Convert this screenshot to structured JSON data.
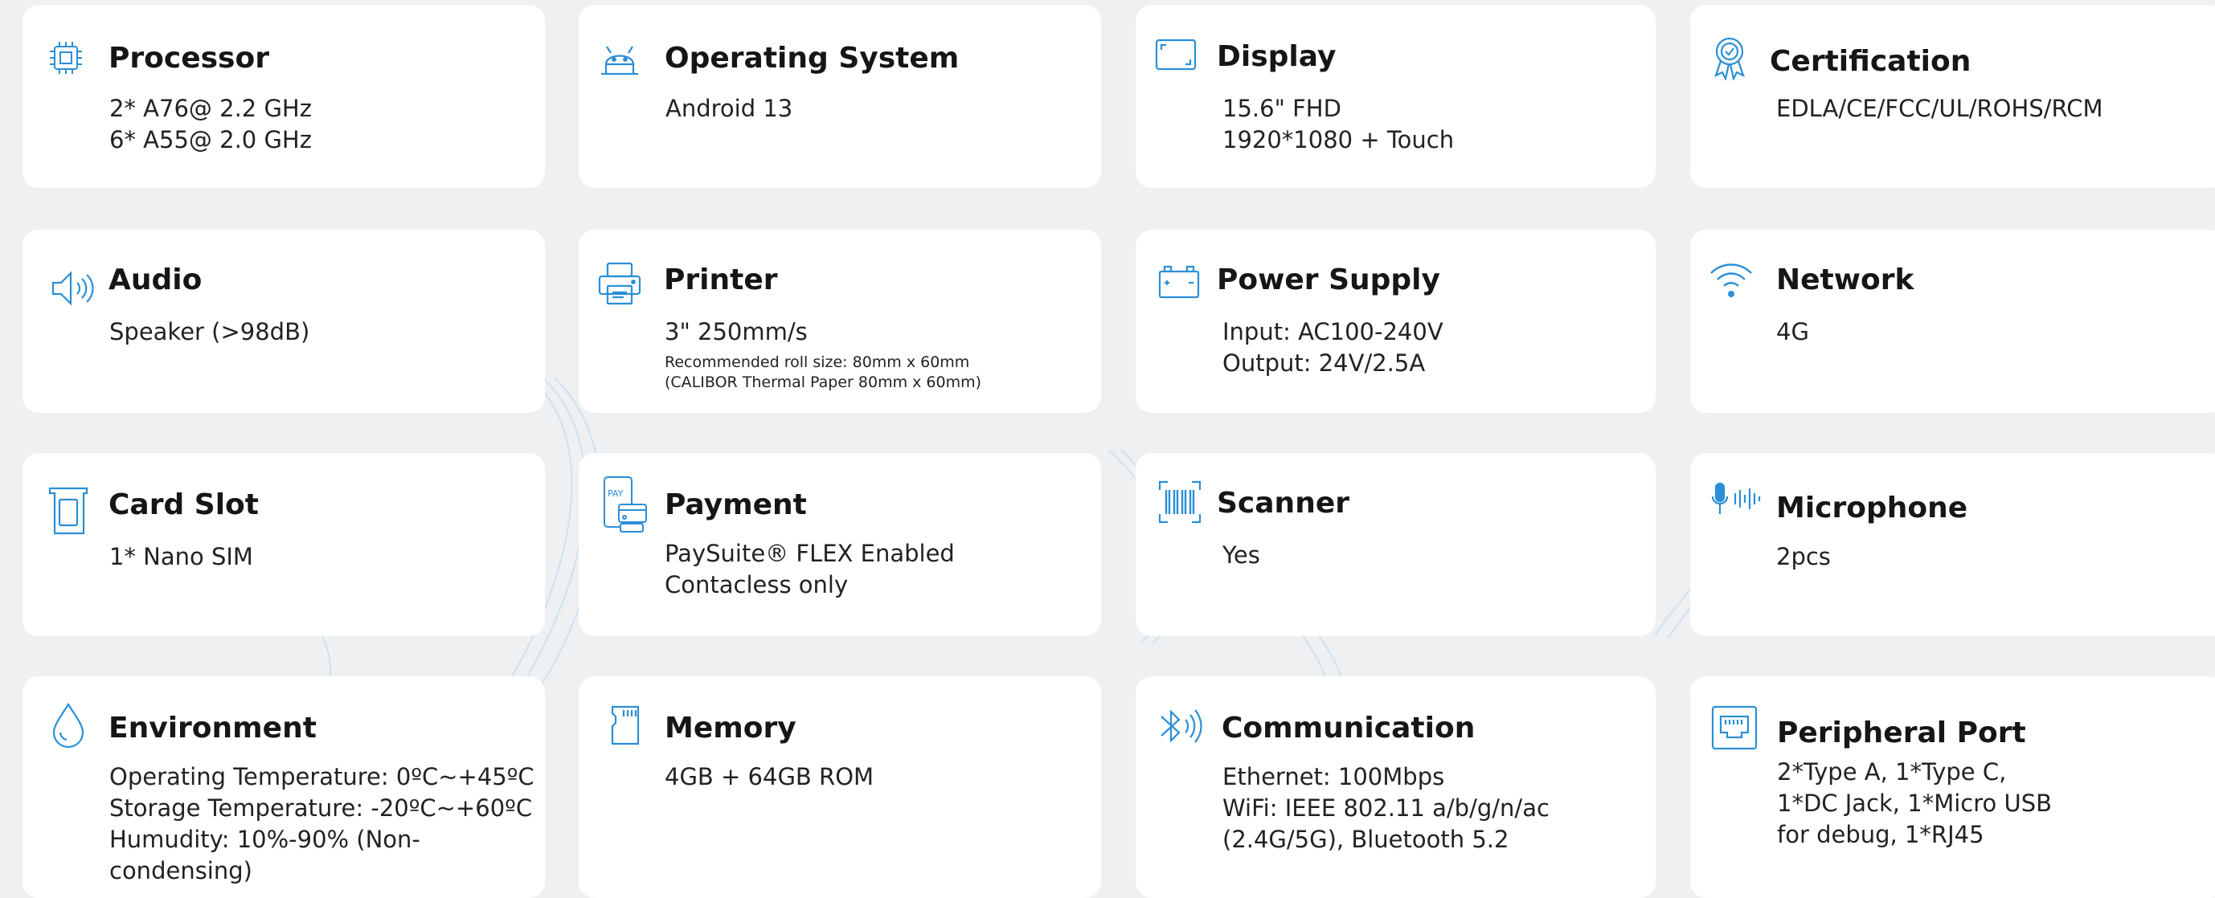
{
  "specs": [
    {
      "icon": "processor-icon",
      "title": "Processor",
      "lines": [
        "2* A76@ 2.2 GHz",
        "6* A55@ 2.0 GHz"
      ]
    },
    {
      "icon": "android-icon",
      "title": "Operating System",
      "lines": [
        "Android 13"
      ]
    },
    {
      "icon": "display-icon",
      "title": "Display",
      "lines": [
        "15.6\" FHD",
        "1920*1080 + Touch"
      ]
    },
    {
      "icon": "certification-badge-icon",
      "title": "Certification",
      "lines": [
        "EDLA/CE/FCC/UL/ROHS/RCM"
      ]
    },
    {
      "icon": "speaker-icon",
      "title": "Audio",
      "lines": [
        "Speaker (>98dB)"
      ]
    },
    {
      "icon": "printer-icon",
      "title": "Printer",
      "lines": [
        "3\" 250mm/s"
      ],
      "notes": [
        "Recommended roll size: 80mm x 60mm",
        "(CALIBOR Thermal Paper 80mm x 60mm)"
      ]
    },
    {
      "icon": "battery-icon",
      "title": "Power Supply",
      "lines": [
        "Input: AC100-240V",
        "Output: 24V/2.5A"
      ]
    },
    {
      "icon": "wifi-icon",
      "title": "Network",
      "lines": [
        "4G"
      ]
    },
    {
      "icon": "sim-card-icon",
      "title": "Card Slot",
      "lines": [
        "1* Nano SIM"
      ]
    },
    {
      "icon": "payment-icon",
      "icon_text": "PAY",
      "title": "Payment",
      "lines": [
        "PaySuite® FLEX Enabled",
        "Contacless only"
      ]
    },
    {
      "icon": "barcode-scanner-icon",
      "title": "Scanner",
      "lines": [
        "Yes"
      ]
    },
    {
      "icon": "microphone-icon",
      "title": "Microphone",
      "lines": [
        "2pcs"
      ]
    },
    {
      "icon": "water-drop-icon",
      "title": "Environment",
      "lines": [
        "Operating Temperature: 0ºC~+45ºC",
        "Storage Temperature: -20ºC~+60ºC",
        "Humudity: 10%-90% (Non-",
        "condensing)"
      ]
    },
    {
      "icon": "memory-card-icon",
      "title": "Memory",
      "lines": [
        "4GB + 64GB ROM"
      ]
    },
    {
      "icon": "bluetooth-icon",
      "title": "Communication",
      "lines": [
        "Ethernet: 100Mbps",
        "WiFi: IEEE 802.11 a/b/g/n/ac",
        "(2.4G/5G), Bluetooth 5.2"
      ]
    },
    {
      "icon": "ethernet-port-icon",
      "title": "Peripheral Port",
      "lines": [
        "2*Type A, 1*Type C,",
        "1*DC Jack, 1*Micro USB",
        "for debug, 1*RJ45"
      ]
    }
  ],
  "colors": {
    "accent": "#2a8fd6",
    "card": "#ffffff",
    "background": "#eef0f2"
  }
}
